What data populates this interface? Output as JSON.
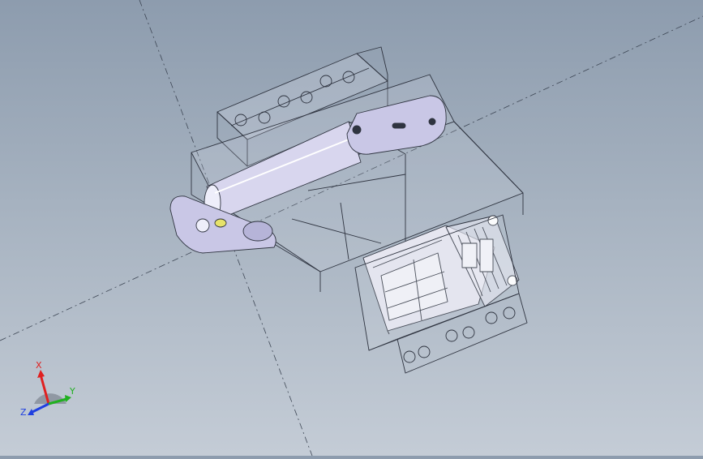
{
  "viewport": {
    "background_top": "#8d9cae",
    "background_bottom": "#c4ccd6",
    "axis_line_color": "#3d4654",
    "wire_color": "#2f3440",
    "face_color": "#e6e6f0",
    "shaft_color": "#d8d6ee",
    "plate_color": "#c9c7e6",
    "accent_yellow": "#e6e26a"
  },
  "triad": {
    "x_label": "X",
    "y_label": "Y",
    "z_label": "Z",
    "x_color": "#e02020",
    "y_color": "#20b020",
    "z_color": "#2040e0"
  }
}
